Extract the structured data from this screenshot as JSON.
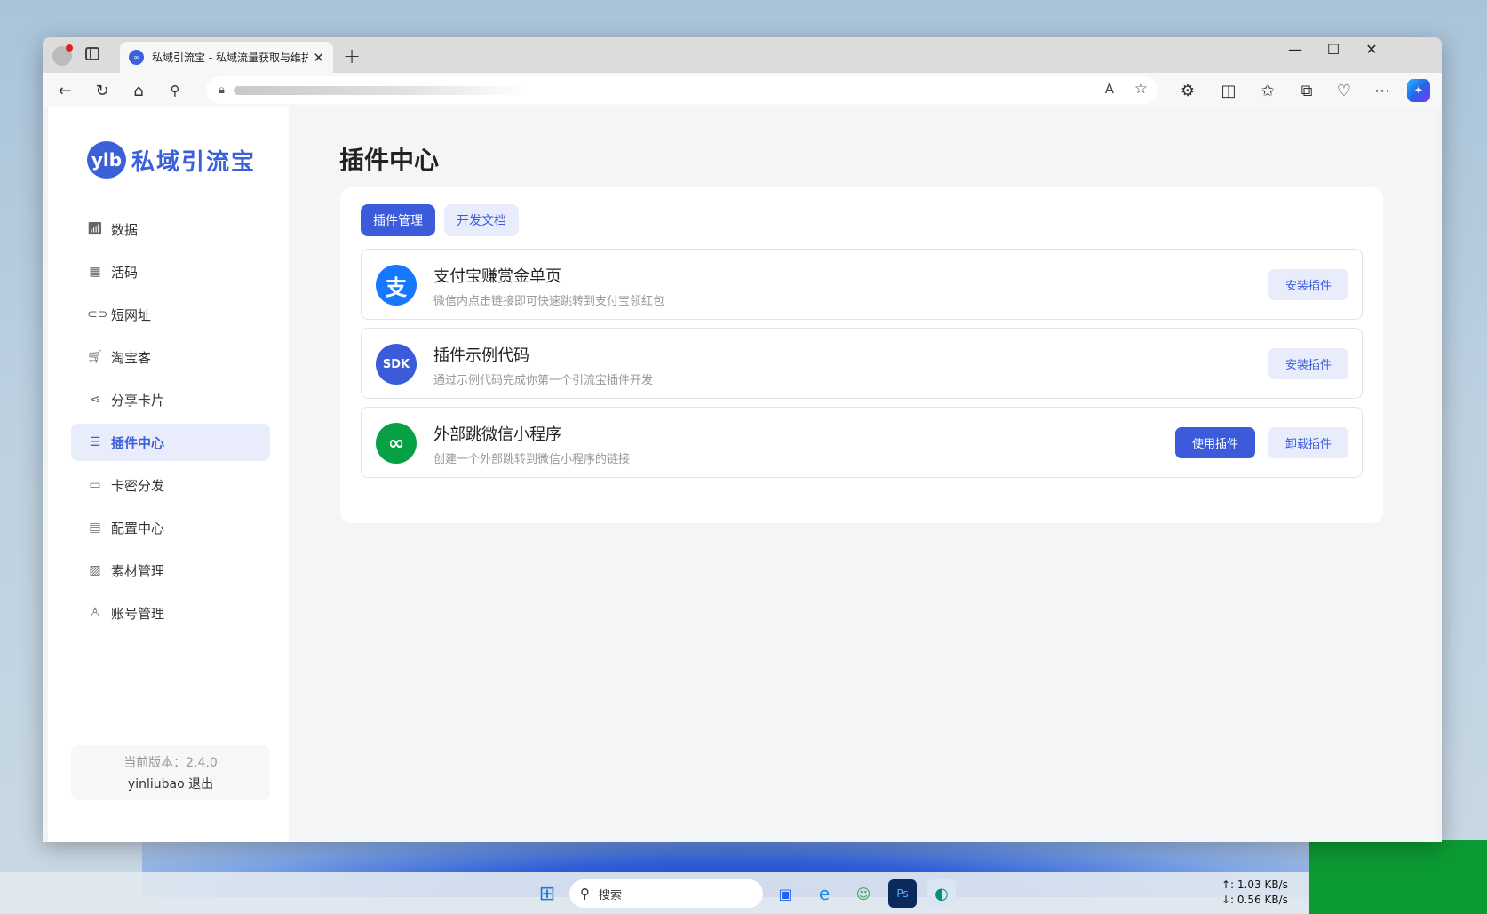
{
  "browser": {
    "tab_title": "私域引流宝 - 私域流量获取与维护",
    "tab_close": "✕",
    "new_tab": "+",
    "win_min": "—",
    "win_max": "☐",
    "win_close": "✕"
  },
  "app": {
    "brand_logo": "ylb",
    "brand_name": "私域引流宝",
    "nav": [
      {
        "label": "数据",
        "icon": "bar-chart-icon"
      },
      {
        "label": "活码",
        "icon": "qr-grid-icon"
      },
      {
        "label": "短网址",
        "icon": "link-icon"
      },
      {
        "label": "淘宝客",
        "icon": "cart-icon"
      },
      {
        "label": "分享卡片",
        "icon": "share-icon"
      },
      {
        "label": "插件中心",
        "icon": "layers-icon",
        "active": true
      },
      {
        "label": "卡密分发",
        "icon": "folder-icon"
      },
      {
        "label": "配置中心",
        "icon": "config-icon"
      },
      {
        "label": "素材管理",
        "icon": "image-icon"
      },
      {
        "label": "账号管理",
        "icon": "user-icon"
      }
    ],
    "version_text": "当前版本：2.4.0",
    "username": "yinliubao",
    "logout": "退出"
  },
  "main": {
    "title": "插件中心",
    "tabs": [
      "插件管理",
      "开发文档"
    ],
    "plugins": [
      {
        "name": "支付宝赚赏金单页",
        "desc": "微信内点击链接即可快速跳转到支付宝领红包",
        "icon_text": "支",
        "buttons": [
          "安装插件"
        ]
      },
      {
        "name": "插件示例代码",
        "desc": "通过示例代码完成你第一个引流宝插件开发",
        "icon_text": "SDK",
        "buttons": [
          "安装插件"
        ]
      },
      {
        "name": "外部跳微信小程序",
        "desc": "创建一个外部跳转到微信小程序的链接",
        "icon_text": "∞",
        "buttons": [
          "使用插件",
          "卸载插件"
        ]
      }
    ]
  },
  "taskbar": {
    "search_placeholder": "搜索",
    "net_up": "↑: 1.03 KB/s",
    "net_down": "↓: 0.56 KB/s"
  },
  "colors": {
    "accent": "#3b5bdb",
    "accent_light": "#e8ecfb",
    "alipay": "#1677ff",
    "sdk": "#3b5bdb",
    "wechat": "#07a045"
  }
}
